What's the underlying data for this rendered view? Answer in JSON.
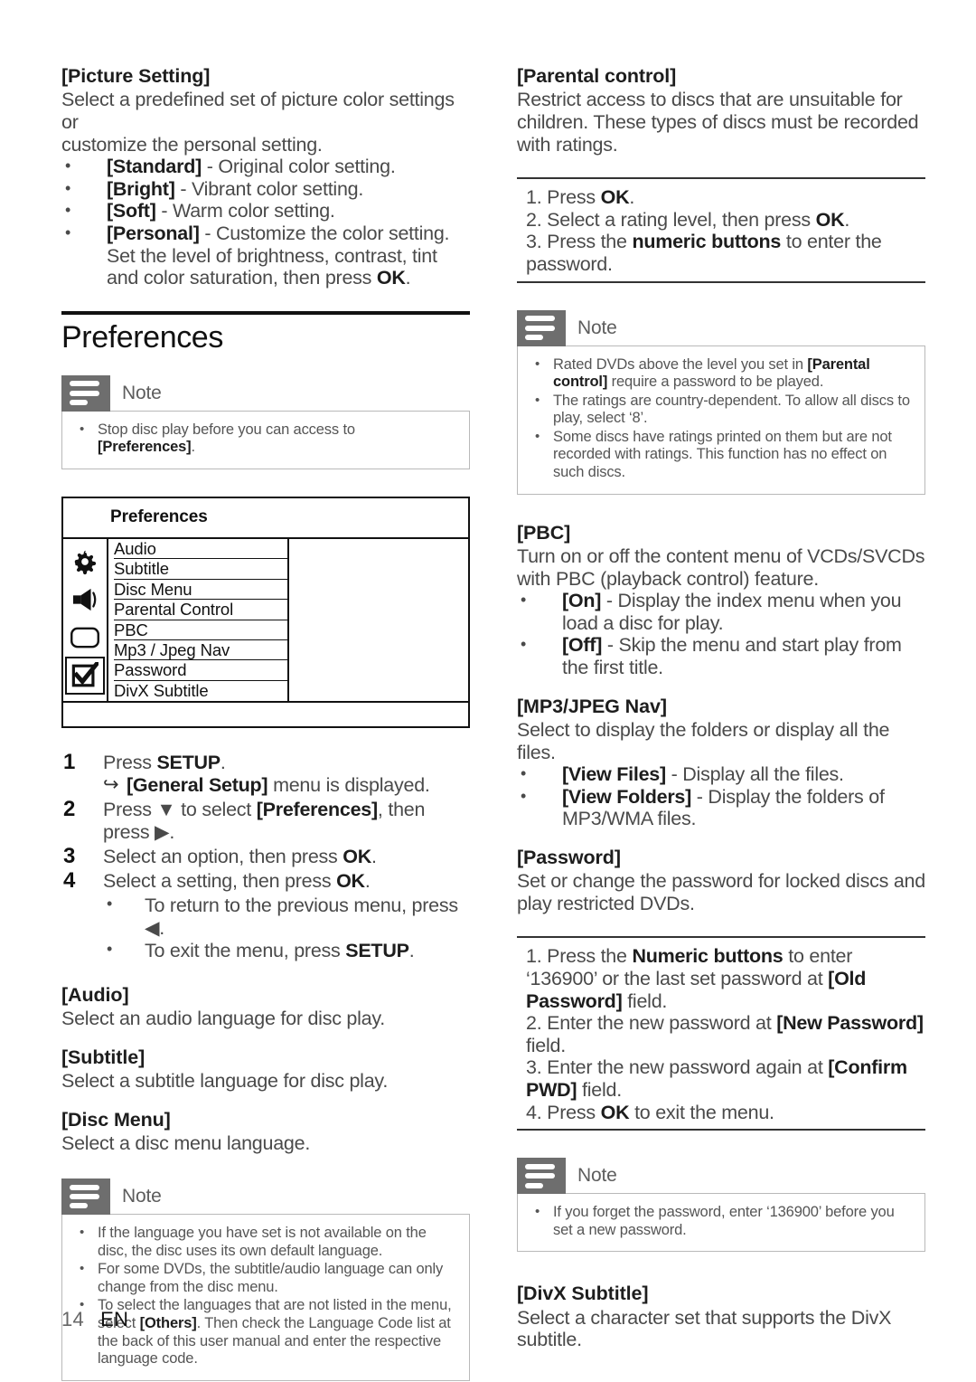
{
  "page": {
    "number": "14",
    "language": "EN"
  },
  "left_column": {
    "picture_setting": {
      "heading": "[Picture Setting]",
      "intro_line1": "Select a predefined set of picture color settings or",
      "intro_line2": "customize the personal setting.",
      "options": [
        {
          "term": "[Standard]",
          "desc": " - Original color setting."
        },
        {
          "term": "[Bright]",
          "desc": " - Vibrant color setting."
        },
        {
          "term": "[Soft]",
          "desc": " - Warm color setting."
        },
        {
          "term": "[Personal]",
          "desc": " - Customize the color setting. Set the level of brightness, contrast, tint and color saturation, then press ",
          "desc_bold": "OK",
          "desc_tail": "."
        }
      ]
    },
    "chapter_title": "Preferences",
    "note_preferences": {
      "label": "Note",
      "items": [
        {
          "pre": "Stop disc play before you can access to ",
          "bold": "[Preferences]",
          "post": "."
        }
      ]
    },
    "menu_mock": {
      "title": "Preferences",
      "icons": [
        "gear-icon",
        "speaker-icon",
        "video-icon",
        "checkbox-icon"
      ],
      "items": [
        "Audio",
        "Subtitle",
        "Disc Menu",
        "Parental Control",
        "PBC",
        "Mp3 / Jpeg Nav",
        "Password",
        "DivX Subtitle"
      ]
    },
    "steps": [
      {
        "pre": "Press ",
        "bold": "SETUP",
        "post": ".",
        "sub_arrow": {
          "bold": "[General Setup]",
          "post": " menu is displayed."
        }
      },
      {
        "pre": "Press ▼ to select ",
        "bold": "[Preferences]",
        "post": ", then press ▶."
      },
      {
        "pre": "Select an option, then press ",
        "bold": "OK",
        "post": "."
      },
      {
        "pre": "Select a setting, then press ",
        "bold": "OK",
        "post": ".",
        "bullets": [
          {
            "pre": "To return to the previous menu, press ◀.",
            "bold": "",
            "post": ""
          },
          {
            "pre": "To exit the menu, press ",
            "bold": "SETUP",
            "post": "."
          }
        ]
      }
    ],
    "audio": {
      "heading": "[Audio]",
      "body": "Select an audio language for disc play."
    },
    "subtitle": {
      "heading": "[Subtitle]",
      "body": "Select a subtitle language for disc play."
    },
    "disc_menu": {
      "heading": "[Disc Menu]",
      "body": "Select a disc menu language."
    },
    "note_language": {
      "label": "Note",
      "items": [
        {
          "pre": "If the language you have set is not available on the disc, the disc uses its own default language.",
          "bold": "",
          "post": ""
        },
        {
          "pre": "For some DVDs, the subtitle/audio language can only change from the disc menu.",
          "bold": "",
          "post": ""
        },
        {
          "pre": "To select the languages that are not listed in the menu, select ",
          "bold": "[Others]",
          "post": ". Then check the Language Code list at the back of this user manual and enter the respective language code."
        }
      ]
    }
  },
  "right_column": {
    "parental_control": {
      "heading": "[Parental control]",
      "body_line1": "Restrict access to discs that are unsuitable for",
      "body_line2": "children. These types of discs must be recorded",
      "body_line3": "with ratings.",
      "procedure": [
        {
          "pre": "1. Press ",
          "bold": "OK",
          "post": "."
        },
        {
          "pre": "2. Select a rating level, then press ",
          "bold": "OK",
          "post": "."
        },
        {
          "pre": "3. Press the ",
          "bold": "numeric buttons",
          "post": " to enter the password."
        }
      ]
    },
    "note_parental": {
      "label": "Note",
      "items": [
        {
          "pre": "Rated DVDs above the level you set in ",
          "bold": "[Parental control]",
          "post": " require a password to be played."
        },
        {
          "pre": "The ratings are country-dependent. To allow all discs to play, select ‘8’.",
          "bold": "",
          "post": ""
        },
        {
          "pre": "Some discs have ratings printed on them but are not recorded with ratings. This function has no effect on such discs.",
          "bold": "",
          "post": ""
        }
      ]
    },
    "pbc": {
      "heading": "[PBC]",
      "body_line1": "Turn on or off the content menu of VCDs/SVCDs",
      "body_line2": "with PBC (playback control) feature.",
      "options": [
        {
          "term": "[On]",
          "desc": " - Display the index menu when you load a disc for play."
        },
        {
          "term": "[Off]",
          "desc": " - Skip the menu and start play from the first title."
        }
      ]
    },
    "mp3_jpeg_nav": {
      "heading": "[MP3/JPEG Nav]",
      "body": "Select to display the folders or display all the files.",
      "options": [
        {
          "term": "[View Files]",
          "desc": " - Display all the files."
        },
        {
          "term": "[View Folders]",
          "desc": " - Display the folders of MP3/WMA files."
        }
      ]
    },
    "password": {
      "heading": "[Password]",
      "body_line1": "Set or change the password for locked discs and",
      "body_line2": "play restricted DVDs.",
      "procedure": [
        {
          "pre": "1. Press the ",
          "bold": "Numeric buttons",
          "post": " to enter ‘136900’ or the last set password at ",
          "bold2": "[Old Password]",
          "post2": " field."
        },
        {
          "pre": "2. Enter the new password at ",
          "bold": "[New Password]",
          "post": " field."
        },
        {
          "pre": "3. Enter the new password again at ",
          "bold": "[Confirm PWD]",
          "post": " field."
        },
        {
          "pre": "4. Press ",
          "bold": "OK",
          "post": " to exit the menu."
        }
      ]
    },
    "note_password": {
      "label": "Note",
      "items": [
        {
          "pre": "If you forget the password, enter ‘136900’ before you set a new password.",
          "bold": "",
          "post": ""
        }
      ]
    },
    "divx_subtitle": {
      "heading": "[DivX Subtitle]",
      "body_line1": "Select a character set that supports the DivX",
      "body_line2": "subtitle."
    }
  },
  "colors": {
    "note_badge": "#6e6e6e",
    "body_text": "#4a4a4a",
    "heading_text": "#1d1d1d",
    "rule": "#111111"
  }
}
